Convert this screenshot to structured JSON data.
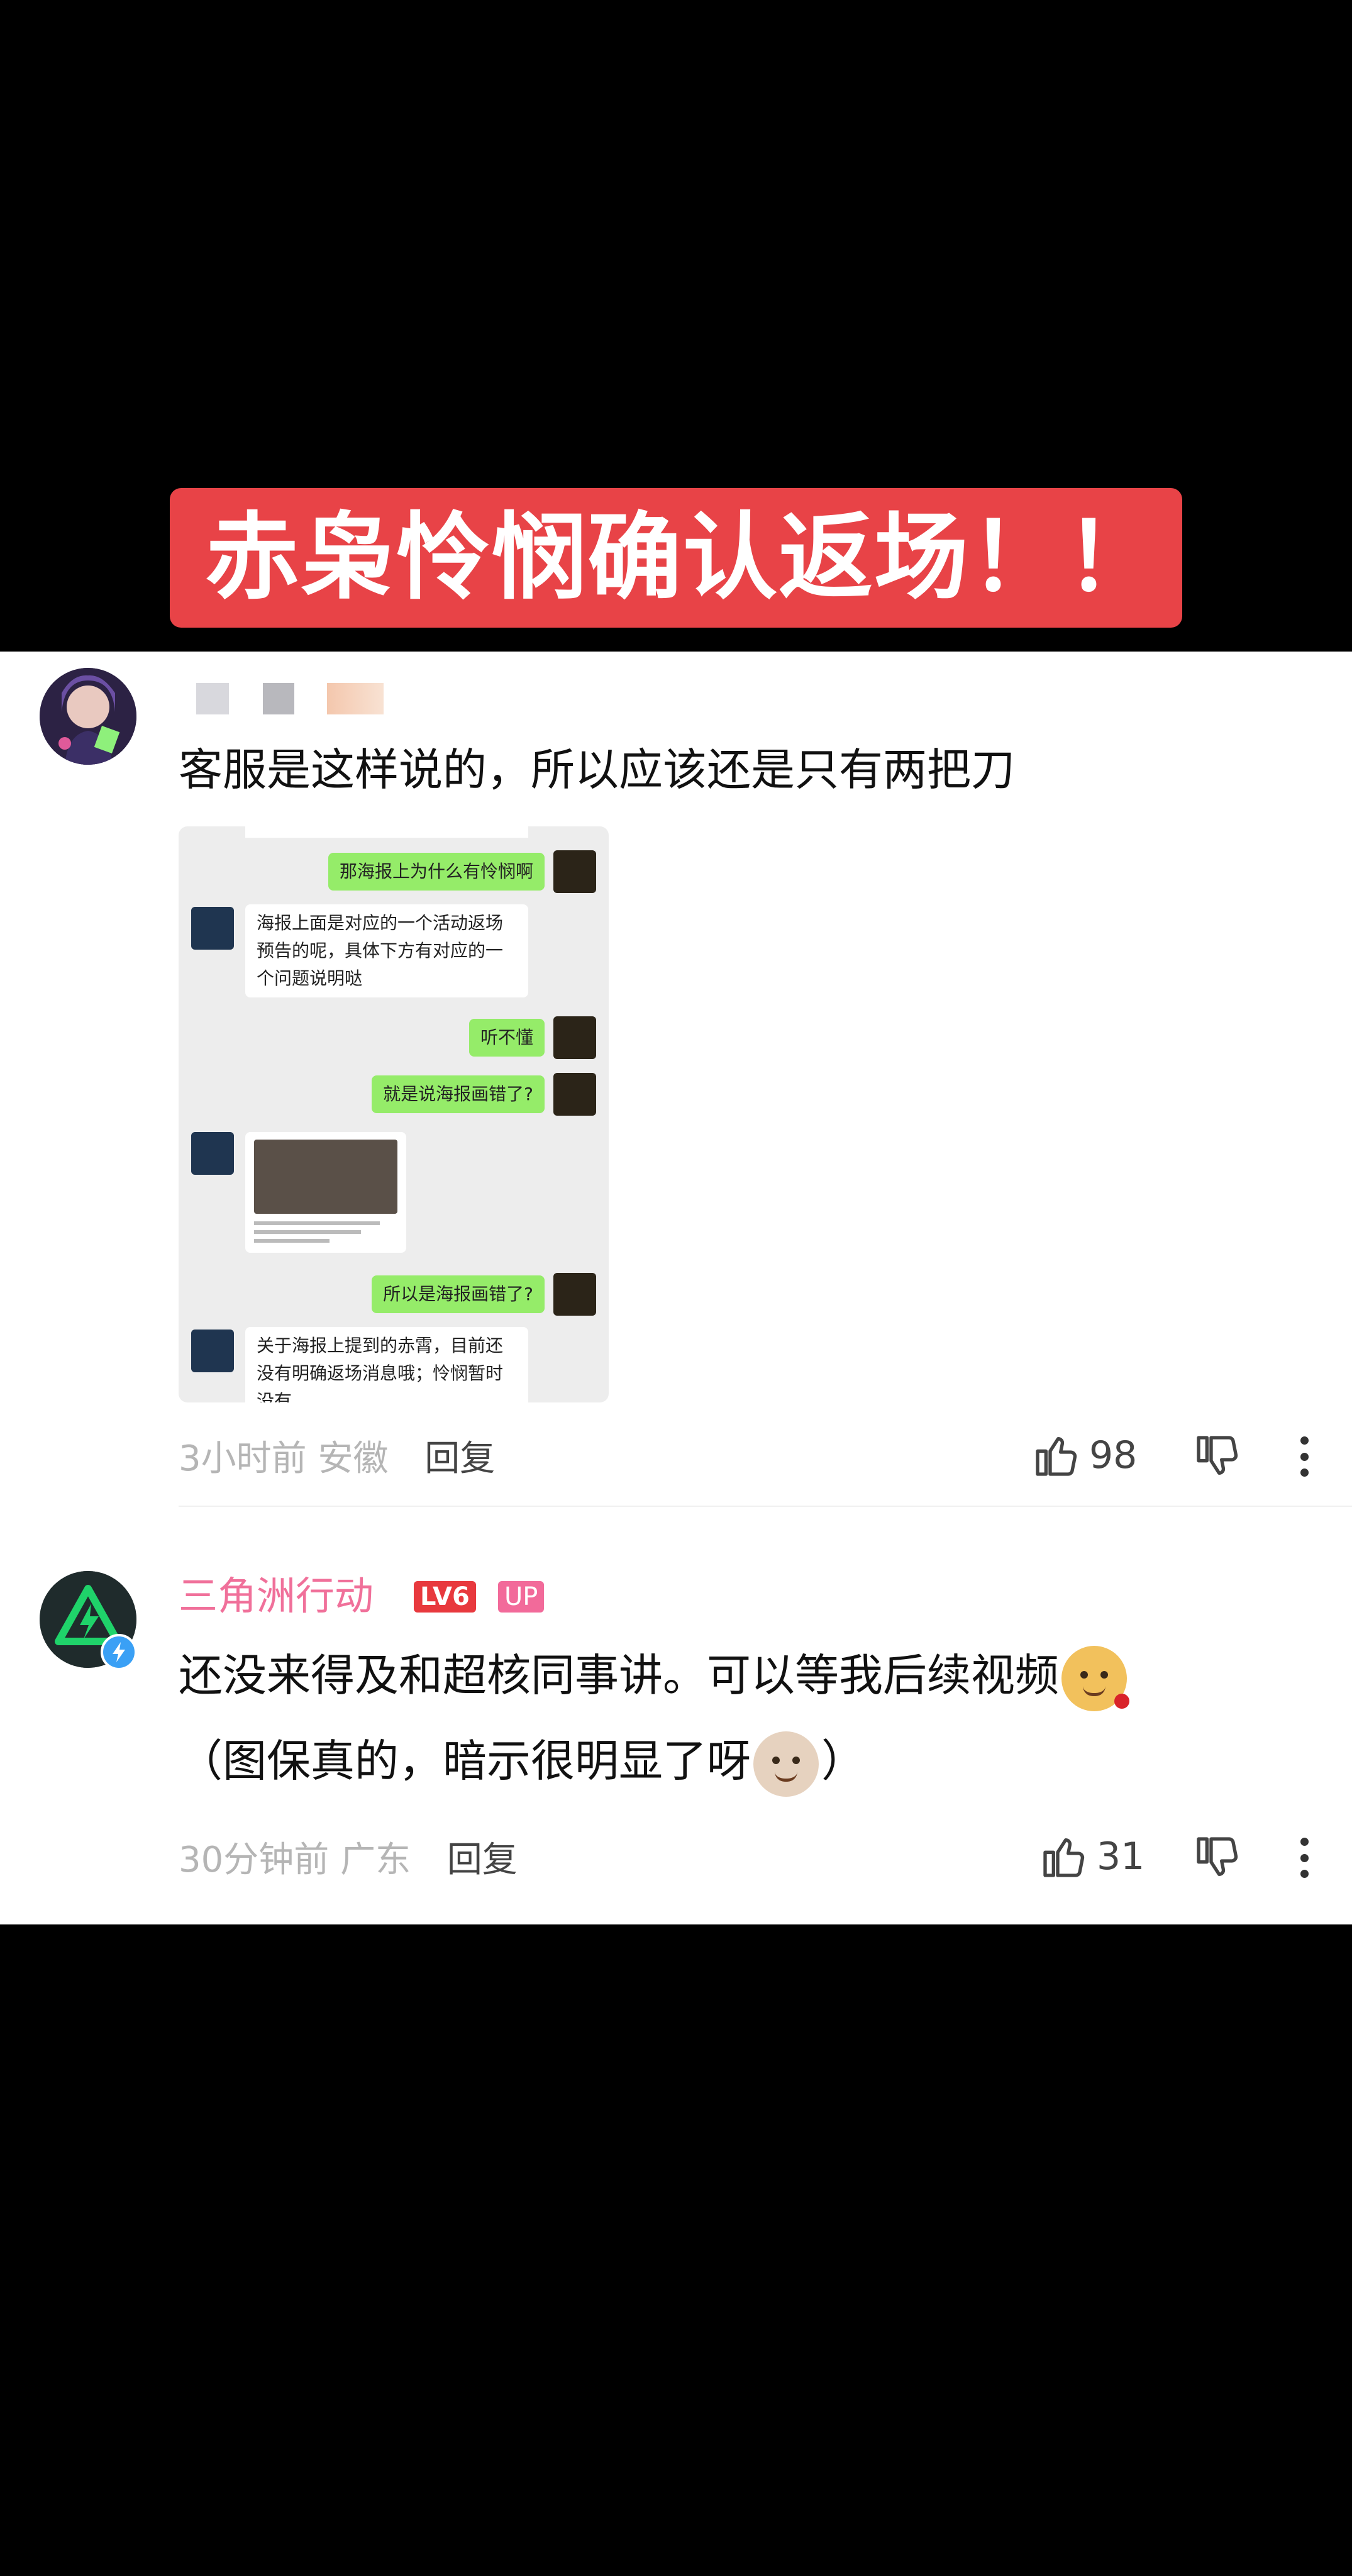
{
  "title_banner": {
    "text": "赤枭怜悯确认返场！！"
  },
  "comments": [
    {
      "text": "客服是这样说的，所以应该还是只有两把刀",
      "meta_time": "3小时前",
      "meta_location": "安徽",
      "reply_label": "回复",
      "likes": "98",
      "chat_screenshot": {
        "messages": [
          {
            "side": "me",
            "text": "那海报上为什么有怜悯啊"
          },
          {
            "side": "cs",
            "text": "海报上面是对应的一个活动返场预告的呢，具体下方有对应的一个问题说明哒"
          },
          {
            "side": "me",
            "text": "听不懂"
          },
          {
            "side": "me",
            "text": "就是说海报画错了?"
          },
          {
            "side": "me",
            "text": "所以是海报画错了?"
          },
          {
            "side": "cs",
            "text": "关于海报上提到的赤霄，目前还没有明确返场消息哦；怜悯暂时没有"
          }
        ]
      }
    },
    {
      "username": "三角洲行动",
      "level_badge": "LV6",
      "up_badge": "UP",
      "text_a": "还没来得及和超核同事讲。可以等我后续视频",
      "text_b": "（图保真的，暗示很明显了呀",
      "text_c": "）",
      "meta_time": "30分钟前",
      "meta_location": "广东",
      "reply_label": "回复",
      "likes": "31"
    }
  ],
  "icons": {
    "like": "thumbs-up-icon",
    "dislike": "thumbs-down-icon",
    "more": "more-vertical-icon",
    "verified": "lightning-badge-icon"
  },
  "colors": {
    "banner_red": "#E84347",
    "username_pink": "#F0709A",
    "level_red": "#E8393E",
    "up_pink": "#F26A9A",
    "chat_green": "#95ec69"
  }
}
